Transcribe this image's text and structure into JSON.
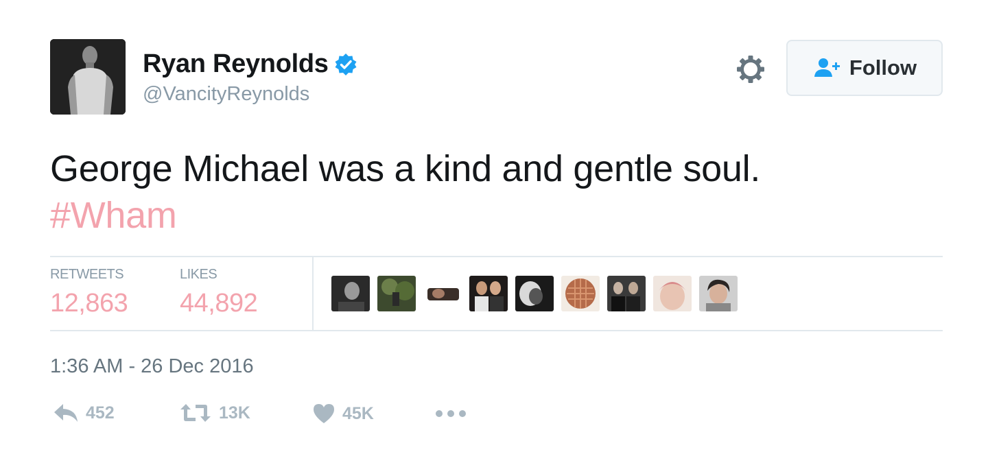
{
  "user": {
    "display_name": "Ryan Reynolds",
    "handle": "@VancityReynolds"
  },
  "follow_button": {
    "label": "Follow"
  },
  "tweet": {
    "text": "George Michael was a kind and gentle soul.",
    "hashtag": "#Wham",
    "timestamp": "1:36 AM - 26 Dec 2016"
  },
  "stats": {
    "retweets_label": "RETWEETS",
    "retweets_value": "12,863",
    "likes_label": "LIKES",
    "likes_value": "44,892"
  },
  "actions": {
    "reply_count": "452",
    "retweet_count": "13K",
    "like_count": "45K"
  },
  "colors": {
    "hashtag_and_stats": "#f3a3ad",
    "verified_badge": "#1da1f2",
    "follow_icon": "#1da1f2",
    "secondary_text": "#8899a6",
    "action_icons": "#aab8c2",
    "divider": "#e1e8ed"
  },
  "icons": {
    "verified": "verified-badge-icon",
    "settings": "gear-icon",
    "follow": "add-user-icon",
    "reply": "reply-icon",
    "retweet": "retweet-icon",
    "like": "heart-icon",
    "more": "more-dots-icon"
  }
}
